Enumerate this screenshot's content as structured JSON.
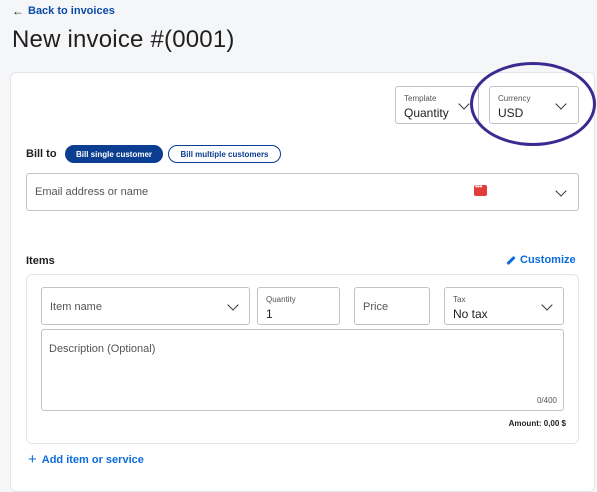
{
  "header": {
    "back_label": "Back to invoices",
    "title": "New invoice #(0001)"
  },
  "template": {
    "label": "Template",
    "value": "Quantity"
  },
  "currency": {
    "label": "Currency",
    "value": "USD"
  },
  "bill_to": {
    "label": "Bill to",
    "single_label": "Bill single customer",
    "multiple_label": "Bill multiple customers",
    "search_placeholder": "Email address or name"
  },
  "items": {
    "label": "Items",
    "customize_label": "Customize",
    "item_name_placeholder": "Item name",
    "quantity_label": "Quantity",
    "quantity_value": "1",
    "price_placeholder": "Price",
    "tax_label": "Tax",
    "tax_value": "No tax",
    "description_placeholder": "Description (Optional)",
    "char_count": "0/400",
    "amount": "Amount: 0,00 $",
    "add_label": "Add item or service"
  },
  "colors": {
    "accent": "#0b6bd8",
    "primary_pill": "#0b3d91",
    "highlight": "#3b2a8f",
    "contact_icon": "#e23c3c"
  }
}
